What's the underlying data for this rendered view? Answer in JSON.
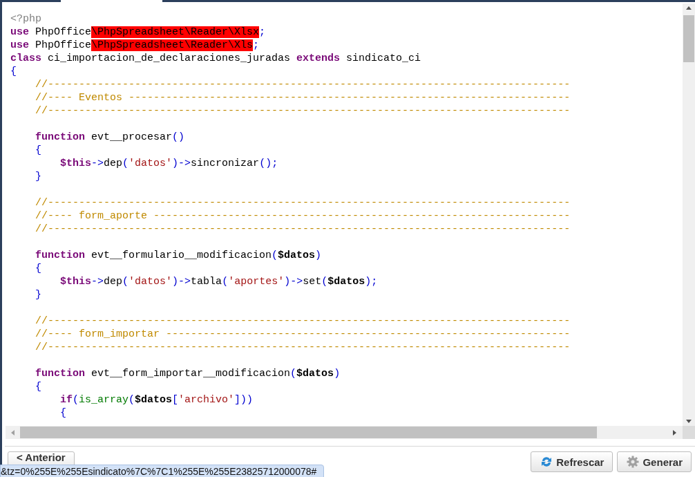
{
  "editor": {
    "lines": [
      {
        "kind": "code",
        "tokens": [
          {
            "kind": "php",
            "text": "<?php"
          }
        ]
      },
      {
        "kind": "code",
        "tokens": [
          {
            "kind": "kw",
            "text": "use"
          },
          {
            "kind": "plain",
            "text": " PhpOffice"
          },
          {
            "kind": "error",
            "text": "\\PhpSpreadsheet\\Reader\\Xlsx"
          },
          {
            "kind": "op",
            "text": ";"
          }
        ]
      },
      {
        "kind": "code",
        "tokens": [
          {
            "kind": "kw",
            "text": "use"
          },
          {
            "kind": "plain",
            "text": " PhpOffice"
          },
          {
            "kind": "error",
            "text": "\\PhpSpreadsheet\\Reader\\Xls"
          },
          {
            "kind": "op",
            "text": ";"
          }
        ]
      },
      {
        "kind": "code",
        "tokens": [
          {
            "kind": "kw",
            "text": "class"
          },
          {
            "kind": "plain",
            "text": " ci_importacion_de_declaraciones_juradas "
          },
          {
            "kind": "kw",
            "text": "extends"
          },
          {
            "kind": "plain",
            "text": " sindicato_ci"
          }
        ]
      },
      {
        "kind": "code",
        "tokens": [
          {
            "kind": "op",
            "text": "{"
          }
        ]
      },
      {
        "kind": "code",
        "tokens": [
          {
            "kind": "comment",
            "text": "    //------------------------------------------------------------------------------------"
          }
        ]
      },
      {
        "kind": "code",
        "tokens": [
          {
            "kind": "comment",
            "text": "    //---- Eventos -----------------------------------------------------------------------"
          }
        ]
      },
      {
        "kind": "code",
        "tokens": [
          {
            "kind": "comment",
            "text": "    //------------------------------------------------------------------------------------"
          }
        ]
      },
      {
        "kind": "blank"
      },
      {
        "kind": "code",
        "tokens": [
          {
            "kind": "kw",
            "text": "    function"
          },
          {
            "kind": "plain",
            "text": " evt__procesar"
          },
          {
            "kind": "op",
            "text": "()"
          }
        ]
      },
      {
        "kind": "code",
        "tokens": [
          {
            "kind": "op",
            "text": "    {"
          }
        ]
      },
      {
        "kind": "code",
        "tokens": [
          {
            "kind": "this",
            "text": "        $this"
          },
          {
            "kind": "op",
            "text": "->"
          },
          {
            "kind": "plain",
            "text": "dep"
          },
          {
            "kind": "op",
            "text": "("
          },
          {
            "kind": "string",
            "text": "'datos'"
          },
          {
            "kind": "op",
            "text": ")->"
          },
          {
            "kind": "plain",
            "text": "sincronizar"
          },
          {
            "kind": "op",
            "text": "();"
          }
        ]
      },
      {
        "kind": "code",
        "tokens": [
          {
            "kind": "op",
            "text": "    }"
          }
        ]
      },
      {
        "kind": "blank"
      },
      {
        "kind": "code",
        "tokens": [
          {
            "kind": "comment",
            "text": "    //------------------------------------------------------------------------------------"
          }
        ]
      },
      {
        "kind": "code",
        "tokens": [
          {
            "kind": "comment",
            "text": "    //---- form_aporte -------------------------------------------------------------------"
          }
        ]
      },
      {
        "kind": "code",
        "tokens": [
          {
            "kind": "comment",
            "text": "    //------------------------------------------------------------------------------------"
          }
        ]
      },
      {
        "kind": "blank"
      },
      {
        "kind": "code",
        "tokens": [
          {
            "kind": "kw",
            "text": "    function"
          },
          {
            "kind": "plain",
            "text": " evt__formulario__modificacion"
          },
          {
            "kind": "op",
            "text": "("
          },
          {
            "kind": "var",
            "text": "$datos"
          },
          {
            "kind": "op",
            "text": ")"
          }
        ]
      },
      {
        "kind": "code",
        "tokens": [
          {
            "kind": "op",
            "text": "    {"
          }
        ]
      },
      {
        "kind": "code",
        "tokens": [
          {
            "kind": "this",
            "text": "        $this"
          },
          {
            "kind": "op",
            "text": "->"
          },
          {
            "kind": "plain",
            "text": "dep"
          },
          {
            "kind": "op",
            "text": "("
          },
          {
            "kind": "string",
            "text": "'datos'"
          },
          {
            "kind": "op",
            "text": ")->"
          },
          {
            "kind": "plain",
            "text": "tabla"
          },
          {
            "kind": "op",
            "text": "("
          },
          {
            "kind": "string",
            "text": "'aportes'"
          },
          {
            "kind": "op",
            "text": ")->"
          },
          {
            "kind": "plain",
            "text": "set"
          },
          {
            "kind": "op",
            "text": "("
          },
          {
            "kind": "var",
            "text": "$datos"
          },
          {
            "kind": "op",
            "text": ");"
          }
        ]
      },
      {
        "kind": "code",
        "tokens": [
          {
            "kind": "op",
            "text": "    }"
          }
        ]
      },
      {
        "kind": "blank"
      },
      {
        "kind": "code",
        "tokens": [
          {
            "kind": "comment",
            "text": "    //------------------------------------------------------------------------------------"
          }
        ]
      },
      {
        "kind": "code",
        "tokens": [
          {
            "kind": "comment",
            "text": "    //---- form_importar -----------------------------------------------------------------"
          }
        ]
      },
      {
        "kind": "code",
        "tokens": [
          {
            "kind": "comment",
            "text": "    //------------------------------------------------------------------------------------"
          }
        ]
      },
      {
        "kind": "blank"
      },
      {
        "kind": "code",
        "tokens": [
          {
            "kind": "kw",
            "text": "    function"
          },
          {
            "kind": "plain",
            "text": " evt__form_importar__modificacion"
          },
          {
            "kind": "op",
            "text": "("
          },
          {
            "kind": "var",
            "text": "$datos"
          },
          {
            "kind": "op",
            "text": ")"
          }
        ]
      },
      {
        "kind": "code",
        "tokens": [
          {
            "kind": "op",
            "text": "    {"
          }
        ]
      },
      {
        "kind": "code",
        "tokens": [
          {
            "kind": "kw",
            "text": "        if"
          },
          {
            "kind": "op",
            "text": "("
          },
          {
            "kind": "func",
            "text": "is_array"
          },
          {
            "kind": "op",
            "text": "("
          },
          {
            "kind": "var",
            "text": "$datos"
          },
          {
            "kind": "op",
            "text": "["
          },
          {
            "kind": "string",
            "text": "'archivo'"
          },
          {
            "kind": "op",
            "text": "]))"
          }
        ]
      },
      {
        "kind": "code",
        "tokens": [
          {
            "kind": "op",
            "text": "        {"
          }
        ]
      }
    ]
  },
  "buttons": [
    {
      "kind": "back",
      "label": "< Anterior"
    },
    {
      "kind": "refresh",
      "label": "Refrescar"
    },
    {
      "kind": "generate",
      "label": "Generar"
    }
  ],
  "status_url": "&tz=0%255E%255Esindicato%7C%7C1%255E%255E23825712000078#"
}
